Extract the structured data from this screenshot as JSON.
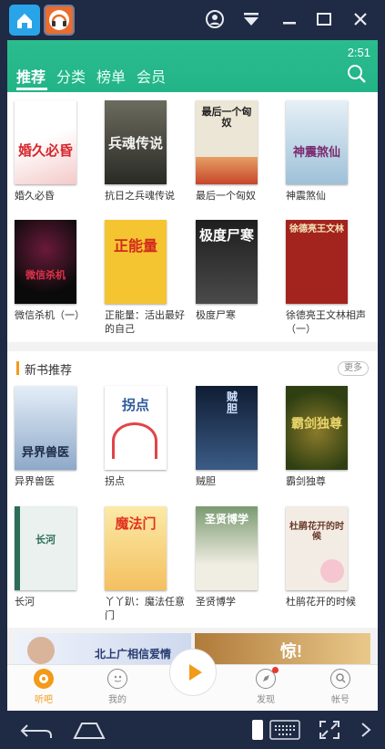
{
  "status": {
    "time": "2:51"
  },
  "nav": {
    "tabs": [
      "推荐",
      "分类",
      "榜单",
      "会员"
    ]
  },
  "recommended": {
    "books": [
      {
        "title": "婚久必昏",
        "cover_text": "婚久必昏",
        "cover_bg": "#ffffff",
        "cover_fg": "#d7262b"
      },
      {
        "title": "抗日之兵魂传说",
        "cover_text": "兵魂传说",
        "cover_bg": "#3a3a36",
        "cover_fg": "#f1f1f1"
      },
      {
        "title": "最后一个匈奴",
        "cover_text": "最后一个匈奴",
        "cover_bg": "#ece6d6",
        "cover_fg": "#222222"
      },
      {
        "title": "神震煞仙",
        "cover_text": "神震煞仙",
        "cover_bg": "#cfe3ef",
        "cover_fg": "#7a2a6e"
      },
      {
        "title": "微信杀机（一）",
        "cover_text": "微信杀机",
        "cover_bg": "#111111",
        "cover_fg": "#e0324a"
      },
      {
        "title": "正能量：活出最好的自己",
        "cover_text": "正能量",
        "cover_bg": "#f5c431",
        "cover_fg": "#d12b1c"
      },
      {
        "title": "极度尸寒",
        "cover_text": "极度尸寒",
        "cover_bg": "#2a2a2a",
        "cover_fg": "#ffffff"
      },
      {
        "title": "徐德亮王文林相声（一）",
        "cover_text": "徐德亮王文林",
        "cover_bg": "#a3241e",
        "cover_fg": "#f4e4b8"
      }
    ]
  },
  "new_books": {
    "title": "新书推荐",
    "more_label": "更多",
    "books": [
      {
        "title": "异界兽医",
        "cover_text": "异界兽医",
        "cover_bg": "#c9d9ec",
        "cover_fg": "#1b2a48"
      },
      {
        "title": "拐点",
        "cover_text": "拐点",
        "cover_bg": "#ffffff",
        "cover_fg": "#2d5a9c"
      },
      {
        "title": "贼胆",
        "cover_text": "贼胆",
        "cover_bg": "#1d3254",
        "cover_fg": "#cfe0ff"
      },
      {
        "title": "霸剑独尊",
        "cover_text": "霸剑独尊",
        "cover_bg": "#4a5c1e",
        "cover_fg": "#e8d56a"
      },
      {
        "title": "长河",
        "cover_text": "长河",
        "cover_bg": "#eaf1ee",
        "cover_fg": "#2c6d5a"
      },
      {
        "title": "丫丫趴：魔法任意门",
        "cover_text": "魔法门",
        "cover_bg": "#fbeaa7",
        "cover_fg": "#e2321f"
      },
      {
        "title": "圣贤博学",
        "cover_text": "圣贤博学",
        "cover_bg": "#5e7d57",
        "cover_fg": "#ffffff"
      },
      {
        "title": "杜鹃花开的时候",
        "cover_text": "杜鹃花开的时候",
        "cover_bg": "#f3ece4",
        "cover_fg": "#6a3a2a"
      }
    ]
  },
  "banners": [
    {
      "text": "北上广相信爱情",
      "bg": "#cfd9ee",
      "fg": "#273c6e"
    },
    {
      "text": "惊!",
      "bg": "#e9c98a",
      "fg": "#ffffff"
    }
  ],
  "bottom_nav": {
    "items": [
      "听吧",
      "我的",
      "发现",
      "帐号"
    ],
    "active_color": "#f39a18"
  },
  "colors": {
    "accent": "#2bbc8e",
    "orange": "#f39a18"
  }
}
